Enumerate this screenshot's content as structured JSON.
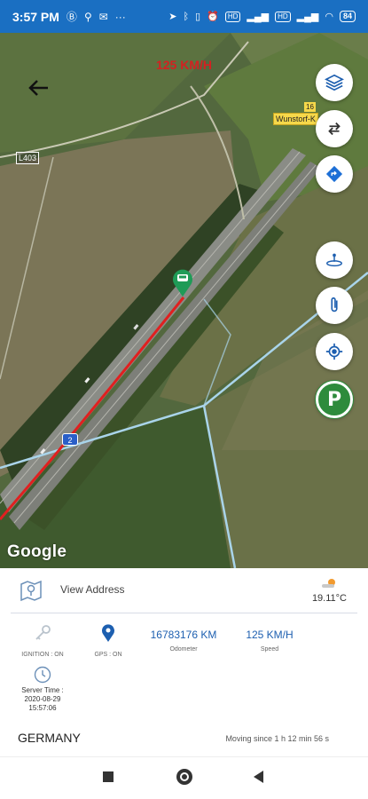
{
  "statusbar": {
    "time": "3:57 PM",
    "left_icons": [
      "bold-b-icon",
      "location-pin-icon",
      "mail-icon",
      "more-dots-icon"
    ],
    "right_icons": [
      "navigation-icon",
      "bluetooth-icon",
      "vibrate-icon",
      "alarm-icon",
      "hd-icon",
      "signal-icon",
      "signal-icon",
      "wifi-icon",
      "battery-icon"
    ],
    "hd1": "HD",
    "hd2": "HD",
    "battery": "84"
  },
  "map": {
    "speed_overlay": "125 KM/H",
    "road_l403": "L403",
    "road_16": "16",
    "road_wunstorf": "Wunstorf-K",
    "route_badge": "2",
    "google_logo": "Google",
    "fab_icons": [
      "layers-icon",
      "swap-icon",
      "directions-icon",
      "geofence-icon",
      "attachment-icon",
      "locate-icon",
      "parking-icon"
    ],
    "parking_label": "P"
  },
  "panel": {
    "view_address": "View Address",
    "temperature": "19.11°C",
    "ignition": {
      "label": "IGNITION : ON"
    },
    "gps": {
      "label": "GPS : ON"
    },
    "odometer": {
      "value": "16783176 KM",
      "label": "Odometer"
    },
    "speed": {
      "value": "125 KM/H",
      "label": "Speed"
    },
    "server_time": {
      "label": "Server Time :",
      "date": "2020-08-29",
      "time": "15:57:06"
    },
    "country": "GERMANY",
    "moving": "Moving since 1 h 12 min 56 s"
  },
  "colors": {
    "statusbar": "#1a6fc2",
    "accent": "#1d5fb0",
    "route": "#e02020",
    "parking": "#2e8b3c"
  }
}
